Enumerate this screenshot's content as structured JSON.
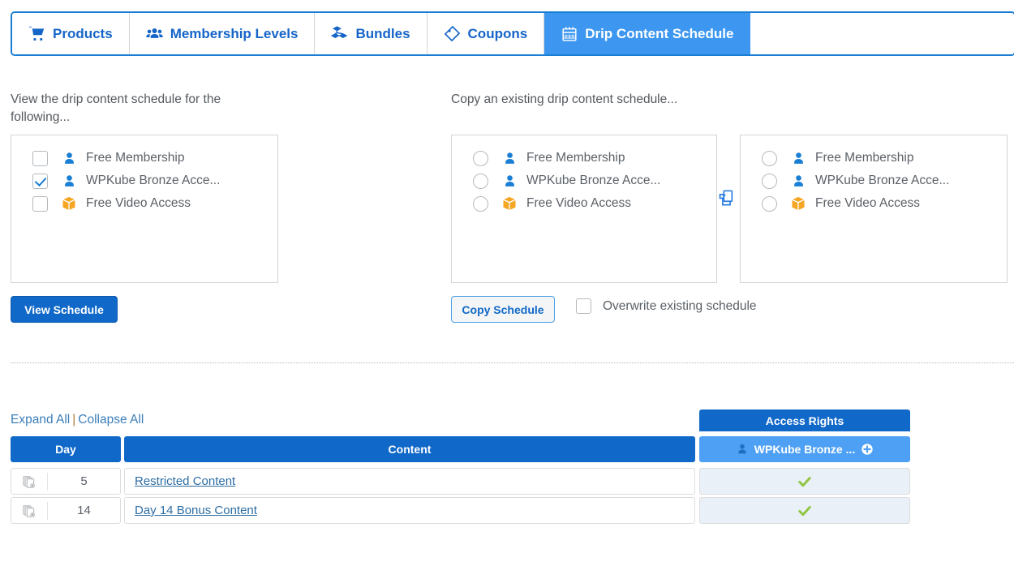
{
  "tabs": [
    {
      "label": "Products",
      "icon": "cart-icon",
      "active": false
    },
    {
      "label": "Membership Levels",
      "icon": "users-icon",
      "active": false
    },
    {
      "label": "Bundles",
      "icon": "bundles-icon",
      "active": false
    },
    {
      "label": "Coupons",
      "icon": "coupon-icon",
      "active": false
    },
    {
      "label": "Drip Content Schedule",
      "icon": "calendar-icon",
      "active": true
    }
  ],
  "view_section": {
    "heading": "View the drip content schedule for the following...",
    "options": [
      {
        "label": "Free Membership",
        "icon": "member-icon",
        "checked": false
      },
      {
        "label": "WPKube Bronze Acce...",
        "icon": "member-icon",
        "checked": true
      },
      {
        "label": "Free Video Access",
        "icon": "bundle-box-icon",
        "checked": false
      }
    ],
    "button_label": "View Schedule"
  },
  "copy_section": {
    "heading": "Copy an existing drip content schedule...",
    "source_options": [
      {
        "label": "Free Membership",
        "icon": "member-icon"
      },
      {
        "label": "WPKube Bronze Acce...",
        "icon": "member-icon"
      },
      {
        "label": "Free Video Access",
        "icon": "bundle-box-icon"
      }
    ],
    "target_options": [
      {
        "label": "Free Membership",
        "icon": "member-icon"
      },
      {
        "label": "WPKube Bronze Acce...",
        "icon": "member-icon"
      },
      {
        "label": "Free Video Access",
        "icon": "bundle-box-icon"
      }
    ],
    "button_label": "Copy Schedule",
    "overwrite_label": "Overwrite existing schedule",
    "overwrite_checked": false
  },
  "schedule_table": {
    "expand_all": "Expand All",
    "separator": "|",
    "collapse_all": "Collapse All",
    "access_rights_header": "Access Rights",
    "columns": {
      "day": "Day",
      "content": "Content",
      "level": "WPKube Bronze ..."
    },
    "rows": [
      {
        "day": "5",
        "content": "Restricted Content",
        "access": "granted"
      },
      {
        "day": "14",
        "content": "Day 14 Bonus Content",
        "access": "granted"
      }
    ]
  },
  "colors": {
    "brand_blue": "#1068c8",
    "tab_active": "#3d97f0",
    "level_header": "#4ea0f5",
    "link": "#3c7eb8",
    "check_green": "#8dc63f",
    "box_orange": "#f5a623",
    "text_gray": "#5b6168"
  }
}
